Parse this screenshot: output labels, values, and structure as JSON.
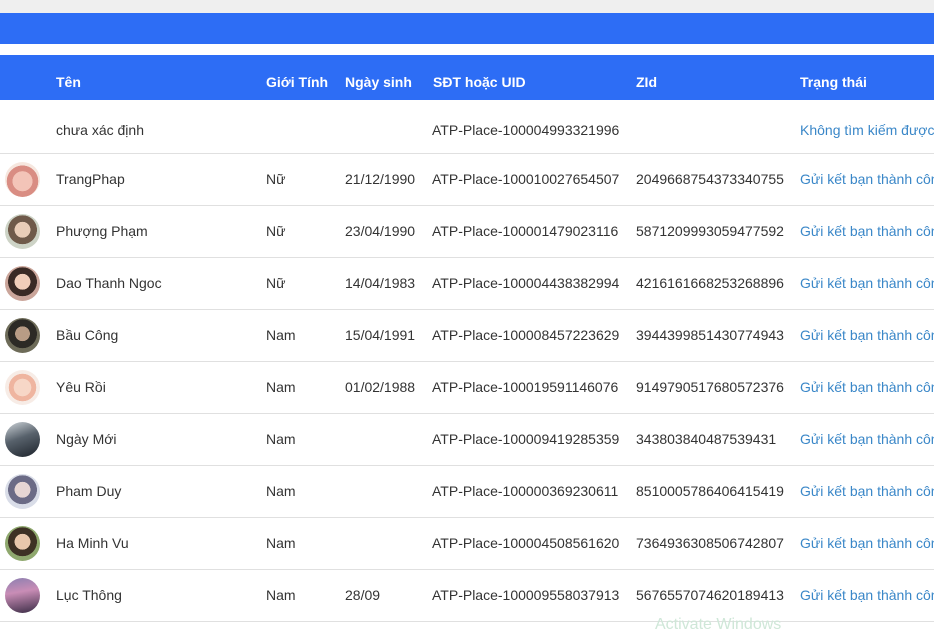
{
  "headers": {
    "name": "Tên",
    "gender": "Giới Tính",
    "birthday": "Ngày sinh",
    "phone_uid": "SĐT hoặc UID",
    "zid": "ZId",
    "status": "Trạng thái"
  },
  "rows": [
    {
      "name": "chưa xác định",
      "gender": "",
      "birthday": "",
      "uid": "ATP-Place-100004993321996",
      "zid": "",
      "status": "Không tìm kiếm được",
      "avatar": ""
    },
    {
      "name": "TrangPhap",
      "gender": "Nữ",
      "birthday": "21/12/1990",
      "uid": "ATP-Place-100010027654507",
      "zid": "2049668754373340755",
      "status": "Gửi kết bạn thành công",
      "avatar": "avatar-photo"
    },
    {
      "name": "Phượng Phạm",
      "gender": "Nữ",
      "birthday": "23/04/1990",
      "uid": "ATP-Place-100001479023116",
      "zid": "5871209993059477592",
      "status": "Gửi kết bạn thành công",
      "avatar": "avatar-photo"
    },
    {
      "name": "Dao Thanh Ngoc",
      "gender": "Nữ",
      "birthday": "14/04/1983",
      "uid": "ATP-Place-100004438382994",
      "zid": "4216161668253268896",
      "status": "Gửi kết bạn thành công",
      "avatar": "avatar-photo"
    },
    {
      "name": "Bầu Công",
      "gender": "Nam",
      "birthday": "15/04/1991",
      "uid": "ATP-Place-100008457223629",
      "zid": "3944399851430774943",
      "status": "Gửi kết bạn thành công",
      "avatar": "avatar-photo"
    },
    {
      "name": "Yêu Rồi",
      "gender": "Nam",
      "birthday": "01/02/1988",
      "uid": "ATP-Place-100019591146076",
      "zid": "9149790517680572376",
      "status": "Gửi kết bạn thành công",
      "avatar": "avatar-photo"
    },
    {
      "name": "Ngày Mới",
      "gender": "Nam",
      "birthday": "",
      "uid": "ATP-Place-100009419285359",
      "zid": "343803840487539431",
      "status": "Gửi kết bạn thành công",
      "avatar": "avatar-photo"
    },
    {
      "name": "Pham Duy",
      "gender": "Nam",
      "birthday": "",
      "uid": "ATP-Place-100000369230611",
      "zid": "8510005786406415419",
      "status": "Gửi kết bạn thành công",
      "avatar": "avatar-photo"
    },
    {
      "name": "Ha Minh Vu",
      "gender": "Nam",
      "birthday": "",
      "uid": "ATP-Place-100004508561620",
      "zid": "7364936308506742807",
      "status": "Gửi kết bạn thành công",
      "avatar": "avatar-photo"
    },
    {
      "name": "Lục Thông",
      "gender": "Nam",
      "birthday": "28/09",
      "uid": "ATP-Place-100009558037913",
      "zid": "5676557074620189413",
      "status": "Gửi kết bạn thành công",
      "avatar": "avatar-photo"
    }
  ],
  "watermark": "Activate Windows",
  "colors": {
    "header": "#2d6df5",
    "status": "#3a87c8",
    "text": "#333333"
  }
}
